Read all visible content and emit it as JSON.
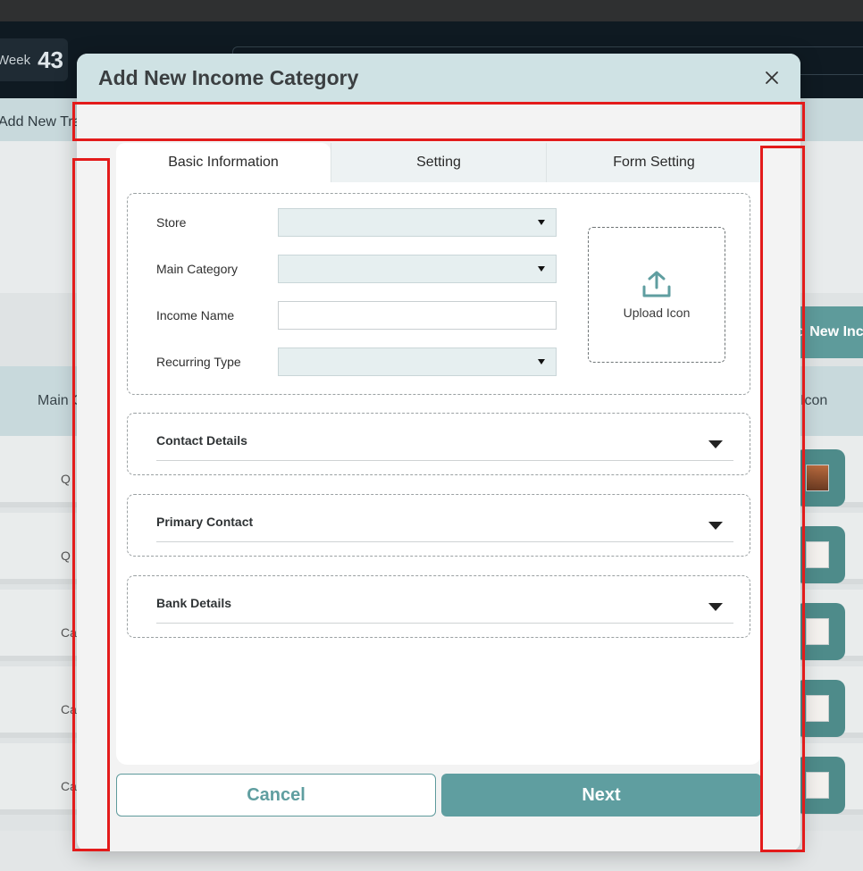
{
  "background": {
    "week_label": "Week",
    "week_number": "43",
    "band_text": "Add New Tra",
    "add_button_text": "d New Inc",
    "table_header_left": "Main C",
    "table_header_right": "Icon",
    "rows": [
      {
        "text": "Q"
      },
      {
        "text": "Q"
      },
      {
        "text": "Ca"
      },
      {
        "text": "Ca"
      },
      {
        "text": "Ca"
      }
    ]
  },
  "modal": {
    "title": "Add New Income Category",
    "tabs": [
      {
        "label": "Basic Information"
      },
      {
        "label": "Setting"
      },
      {
        "label": "Form Setting"
      }
    ],
    "fields": {
      "store": {
        "label": "Store",
        "value": ""
      },
      "main_category": {
        "label": "Main Category",
        "value": ""
      },
      "income_name": {
        "label": "Income Name",
        "value": "",
        "placeholder": ""
      },
      "recurring_type": {
        "label": "Recurring Type",
        "value": ""
      }
    },
    "upload_label": "Upload Icon",
    "sections": [
      {
        "title": "Contact Details"
      },
      {
        "title": "Primary Contact"
      },
      {
        "title": "Bank Details"
      }
    ],
    "buttons": {
      "cancel": "Cancel",
      "next": "Next"
    }
  },
  "colors": {
    "accent": "#5f9ea0",
    "header_bg": "#cfe2e4",
    "annotation_red": "#e31b1b"
  }
}
